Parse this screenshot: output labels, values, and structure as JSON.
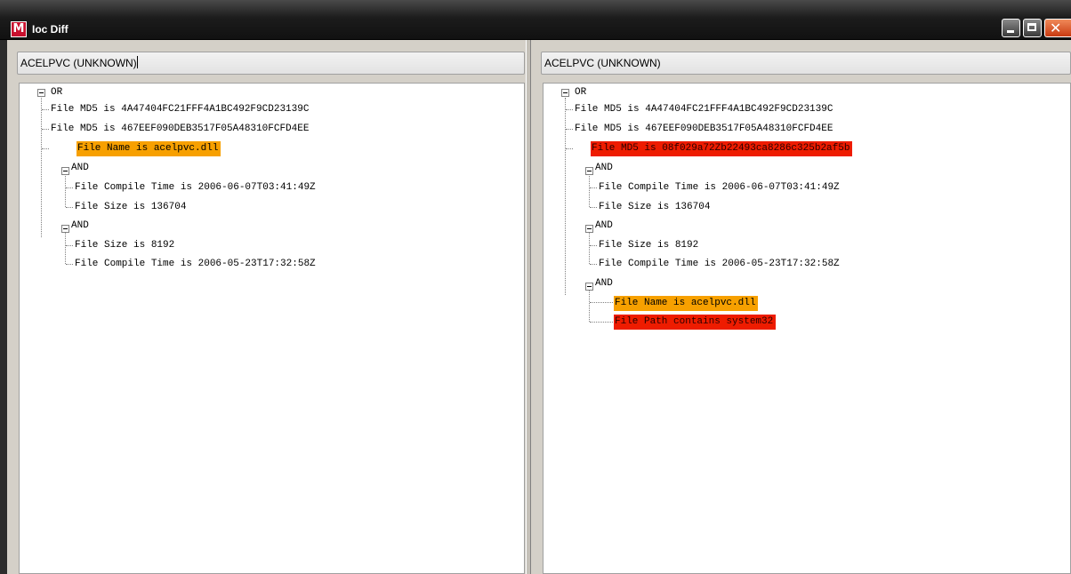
{
  "window": {
    "title": "Ioc Diff",
    "app_icon_letter": "M",
    "controls": {
      "minimize": "minimize",
      "maximize": "maximize",
      "close": "close"
    }
  },
  "left_pane": {
    "header": "ACELPVC (UNKNOWN)",
    "tree": {
      "root": "OR",
      "items": [
        "File MD5 is 4A47404FC21FFF4A1BC492F9CD23139C",
        "File MD5 is 467EEF090DEB3517F05A48310FCFD4EE",
        "File Name is acelpvc.dll"
      ],
      "groups": [
        {
          "label": "AND",
          "items": [
            "File Compile Time is 2006-06-07T03:41:49Z",
            "File Size is 136704"
          ]
        },
        {
          "label": "AND",
          "items": [
            "File Size is 8192",
            "File Compile Time is 2006-05-23T17:32:58Z"
          ]
        }
      ]
    }
  },
  "right_pane": {
    "header": "ACELPVC (UNKNOWN)",
    "tree": {
      "root": "OR",
      "items": [
        "File MD5 is 4A47404FC21FFF4A1BC492F9CD23139C",
        "File MD5 is 467EEF090DEB3517F05A48310FCFD4EE",
        "File MD5 is 08f029a72Zb22493ca8286c325b2af5b"
      ],
      "groups": [
        {
          "label": "AND",
          "items": [
            "File Compile Time is 2006-06-07T03:41:49Z",
            "File Size is 136704"
          ]
        },
        {
          "label": "AND",
          "items": [
            "File Size is 8192",
            "File Compile Time is 2006-05-23T17:32:58Z"
          ]
        },
        {
          "label": "AND",
          "items": [
            "File Name is acelpvc.dll",
            "File Path contains system32"
          ]
        }
      ]
    }
  },
  "highlight_colors": {
    "changed": "#f7a000",
    "added": "#ee1c00"
  }
}
